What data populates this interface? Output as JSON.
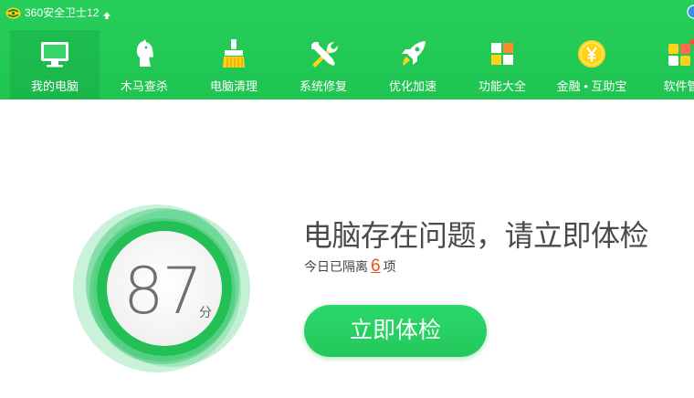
{
  "app": {
    "title": "360安全卫士12",
    "logo_icon": "360-logo-icon",
    "upgrade_icon": "up-arrow-icon"
  },
  "nav": {
    "items": [
      {
        "label": "我的电脑",
        "icon": "computer-icon",
        "active": true
      },
      {
        "label": "木马查杀",
        "icon": "horse-icon",
        "active": false
      },
      {
        "label": "电脑清理",
        "icon": "broom-icon",
        "active": false
      },
      {
        "label": "系统修复",
        "icon": "tools-icon",
        "active": false
      },
      {
        "label": "优化加速",
        "icon": "rocket-icon",
        "active": false
      },
      {
        "label": "功能大全",
        "icon": "grid-apps-icon",
        "active": false
      },
      {
        "label": "金融 • 互助宝",
        "icon": "coin-yuan-icon",
        "active": false
      },
      {
        "label": "软件管",
        "icon": "software-manager-icon",
        "active": false
      }
    ]
  },
  "score": {
    "value": "87",
    "unit": "分"
  },
  "status": {
    "headline": "电脑存在问题，请立即体检",
    "isolated_prefix": "今日已隔离",
    "isolated_count": "6",
    "isolated_suffix": "项"
  },
  "cta": {
    "label": "立即体检"
  },
  "colors": {
    "brand_green": "#22c955",
    "accent_orange": "#e8551c",
    "text_dark": "#4a4a4a"
  }
}
